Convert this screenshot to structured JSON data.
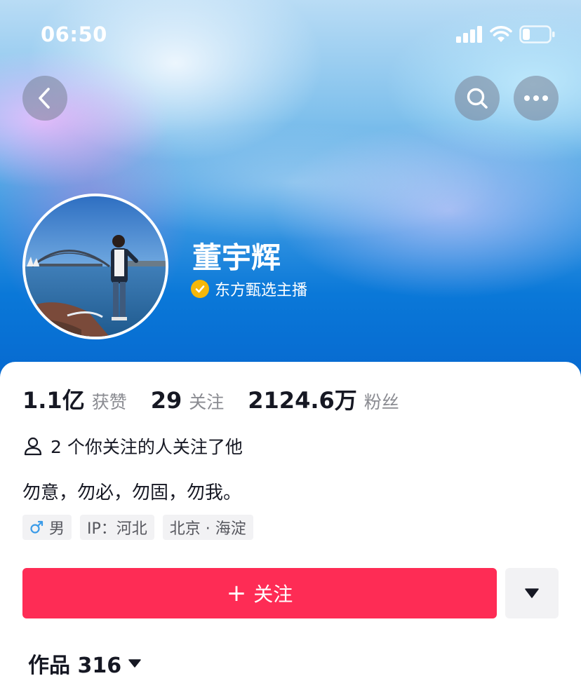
{
  "status_bar": {
    "time": "06:50",
    "icons": [
      "signal-icon",
      "wifi-icon",
      "battery-icon"
    ]
  },
  "nav": {
    "icons": [
      "back-arrow-icon",
      "search-icon",
      "more-icon"
    ]
  },
  "profile": {
    "name": "董宇辉",
    "verified_title": "东方甄选主播",
    "badge_color": "#f5b70a"
  },
  "stats": [
    {
      "value": "1.1亿",
      "label": "获赞"
    },
    {
      "value": "29",
      "label": "关注"
    },
    {
      "value": "2124.6万",
      "label": "粉丝"
    }
  ],
  "mutual": {
    "text": "2 个你关注的人关注了他"
  },
  "bio": "勿意，勿必，勿固，勿我。",
  "tags": [
    {
      "icon": "male-icon",
      "text": "男"
    },
    {
      "text": "IP：河北"
    },
    {
      "text": "北京 · 海淀"
    }
  ],
  "follow_button": {
    "plus": "+",
    "label": "关注",
    "color": "#fe2c55"
  },
  "works_tab": {
    "label": "作品 316"
  }
}
